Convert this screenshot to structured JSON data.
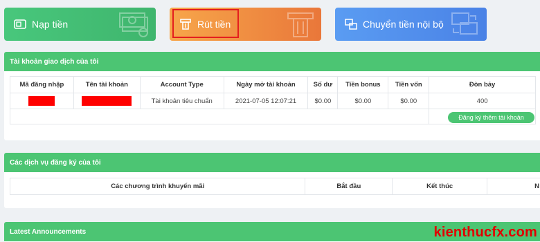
{
  "actions": {
    "deposit_label": "Nạp tiền",
    "withdraw_label": "Rút tiền",
    "transfer_label": "Chuyển tiền nội bộ"
  },
  "accounts_panel": {
    "title": "Tài khoản giao dịch của tôi",
    "columns": [
      "Mã đăng nhập",
      "Tên tài khoản",
      "Account Type",
      "Ngày mở tài khoản",
      "Số dư",
      "Tiền bonus",
      "Tiền vốn",
      "Đòn bảy"
    ],
    "row": {
      "account_type": "Tài khoản tiêu chuẩn",
      "open_date": "2021-07-05 12:07:21",
      "balance": "$0.00",
      "bonus": "$0.00",
      "capital": "$0.00",
      "leverage": "400"
    },
    "register_label": "Đăng ký thêm tài khoản"
  },
  "services_panel": {
    "title": "Các dịch vụ đăng ký của tôi",
    "columns": [
      "Các chương trình khuyến mãi",
      "Bắt đầu",
      "Kết thúc",
      "N"
    ]
  },
  "announcements_panel": {
    "title": "Latest Announcements"
  },
  "watermark": "kienthucfx.com"
}
